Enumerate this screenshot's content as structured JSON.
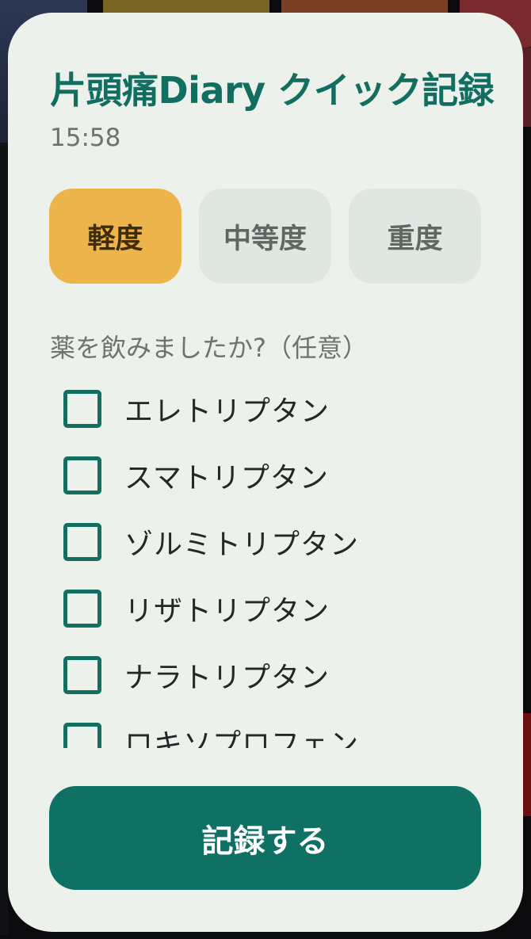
{
  "dialog": {
    "title": "片頭痛Diary クイック記録",
    "time": "15:58"
  },
  "severity": {
    "options": [
      {
        "label": "軽度",
        "selected": true
      },
      {
        "label": "中等度",
        "selected": false
      },
      {
        "label": "重度",
        "selected": false
      }
    ]
  },
  "medications": {
    "question": "薬を飲みましたか?（任意）",
    "items": [
      {
        "label": "エレトリプタン",
        "checked": false
      },
      {
        "label": "スマトリプタン",
        "checked": false
      },
      {
        "label": "ゾルミトリプタン",
        "checked": false
      },
      {
        "label": "リザトリプタン",
        "checked": false
      },
      {
        "label": "ナラトリプタン",
        "checked": false
      },
      {
        "label": "ロキソプロフェン",
        "checked": false
      }
    ]
  },
  "actions": {
    "submit_label": "記録する"
  },
  "colors": {
    "accent": "#136e62",
    "selected_severity": "#ecb44b",
    "submit_button": "#0f7064",
    "sheet_background": "#edf1ec"
  },
  "icons": {
    "checkbox": "checkbox-unchecked-icon"
  }
}
